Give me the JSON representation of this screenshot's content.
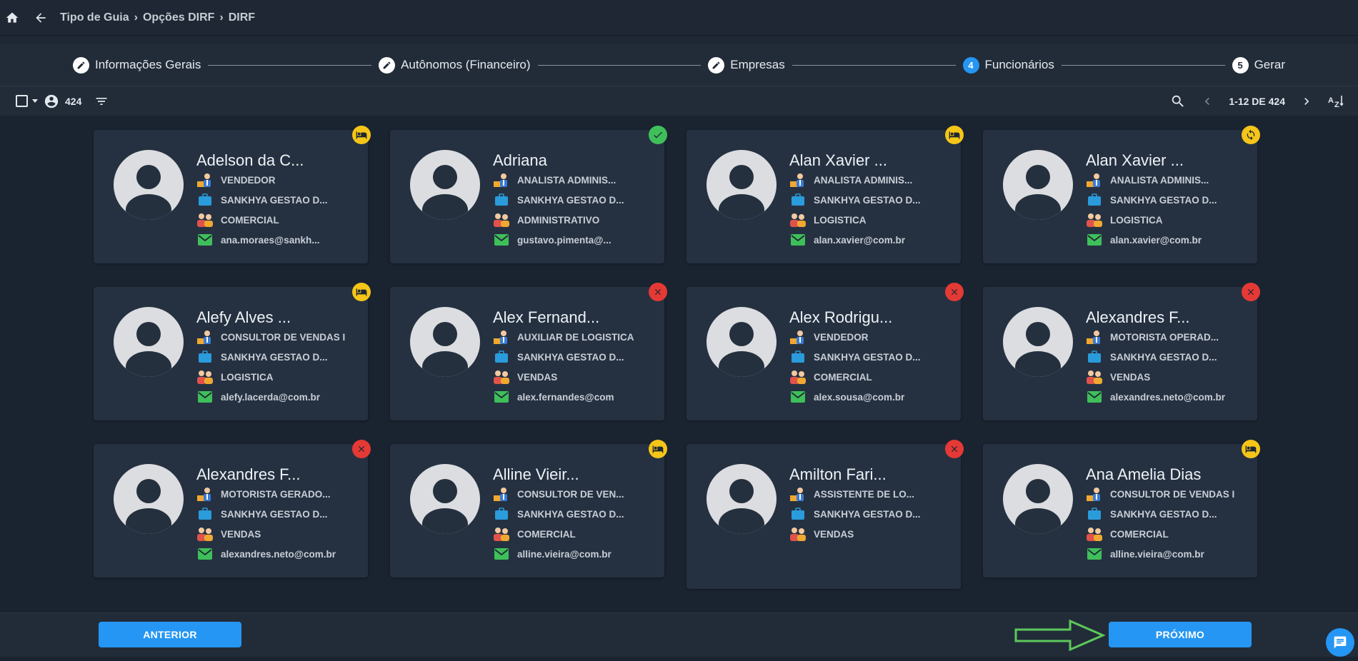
{
  "breadcrumb": {
    "items": [
      "Tipo de Guia",
      "Opções DIRF",
      "DIRF"
    ]
  },
  "stepper": {
    "steps": [
      {
        "number": "",
        "label": "Informações Gerais",
        "state": "done"
      },
      {
        "number": "",
        "label": "Autônomos (Financeiro)",
        "state": "done"
      },
      {
        "number": "",
        "label": "Empresas",
        "state": "done"
      },
      {
        "number": "4",
        "label": "Funcionários",
        "state": "active"
      },
      {
        "number": "5",
        "label": "Gerar",
        "state": "pending"
      }
    ]
  },
  "toolbar": {
    "count": "424",
    "pagination": "1-12 DE 424",
    "sort_icon": "sort-az-icon"
  },
  "cards": [
    {
      "name": "Adelson da C...",
      "role": "VENDEDOR",
      "company": "SANKHYA GESTAO D...",
      "department": "COMERCIAL",
      "email": "ana.moraes@sankh...",
      "status": "bed"
    },
    {
      "name": "Adriana",
      "role": "ANALISTA ADMINIS...",
      "company": "SANKHYA GESTAO D...",
      "department": "ADMINISTRATIVO",
      "email": "gustavo.pimenta@...",
      "status": "check"
    },
    {
      "name": "Alan Xavier ...",
      "role": "ANALISTA ADMINIS...",
      "company": "SANKHYA GESTAO D...",
      "department": "LOGISTICA",
      "email": "alan.xavier@com.br",
      "status": "bed"
    },
    {
      "name": "Alan Xavier ...",
      "role": "ANALISTA ADMINIS...",
      "company": "SANKHYA GESTAO D...",
      "department": "LOGISTICA",
      "email": "alan.xavier@com.br",
      "status": "sync"
    },
    {
      "name": "Alefy Alves ...",
      "role": "CONSULTOR DE VENDAS I",
      "company": "SANKHYA GESTAO D...",
      "department": "LOGISTICA",
      "email": "alefy.lacerda@com.br",
      "status": "bed"
    },
    {
      "name": "Alex Fernand...",
      "role": "AUXILIAR DE LOGISTICA",
      "company": "SANKHYA GESTAO D...",
      "department": "VENDAS",
      "email": "alex.fernandes@com",
      "status": "x"
    },
    {
      "name": "Alex Rodrigu...",
      "role": "VENDEDOR",
      "company": "SANKHYA GESTAO D...",
      "department": "COMERCIAL",
      "email": "alex.sousa@com.br",
      "status": "x"
    },
    {
      "name": "Alexandres F...",
      "role": "MOTORISTA OPERAD...",
      "company": "SANKHYA GESTAO D...",
      "department": "VENDAS",
      "email": "alexandres.neto@com.br",
      "status": "x"
    },
    {
      "name": "Alexandres F...",
      "role": "MOTORISTA GERADO...",
      "company": "SANKHYA GESTAO D...",
      "department": "VENDAS",
      "email": "alexandres.neto@com.br",
      "status": "x"
    },
    {
      "name": "Alline Vieir...",
      "role": "CONSULTOR DE VEN...",
      "company": "SANKHYA GESTAO D...",
      "department": "COMERCIAL",
      "email": "alline.vieira@com.br",
      "status": "bed"
    },
    {
      "name": "Amilton Fari...",
      "role": "ASSISTENTE DE LO...",
      "company": "SANKHYA GESTAO D...",
      "department": "VENDAS",
      "email": "",
      "status": "x"
    },
    {
      "name": "Ana Amelia Dias",
      "role": "CONSULTOR DE VENDAS I",
      "company": "SANKHYA GESTAO D...",
      "department": "COMERCIAL",
      "email": "alline.vieira@com.br",
      "status": "bed"
    }
  ],
  "footer": {
    "prev_label": "ANTERIOR",
    "next_label": "PRÓXIMO"
  },
  "colors": {
    "accent": "#2596f3",
    "background": "#1e2733",
    "card": "#253141",
    "warning": "#f5c518",
    "success": "#3fbf5a",
    "error": "#e53935",
    "arrow": "#5cc95a"
  }
}
